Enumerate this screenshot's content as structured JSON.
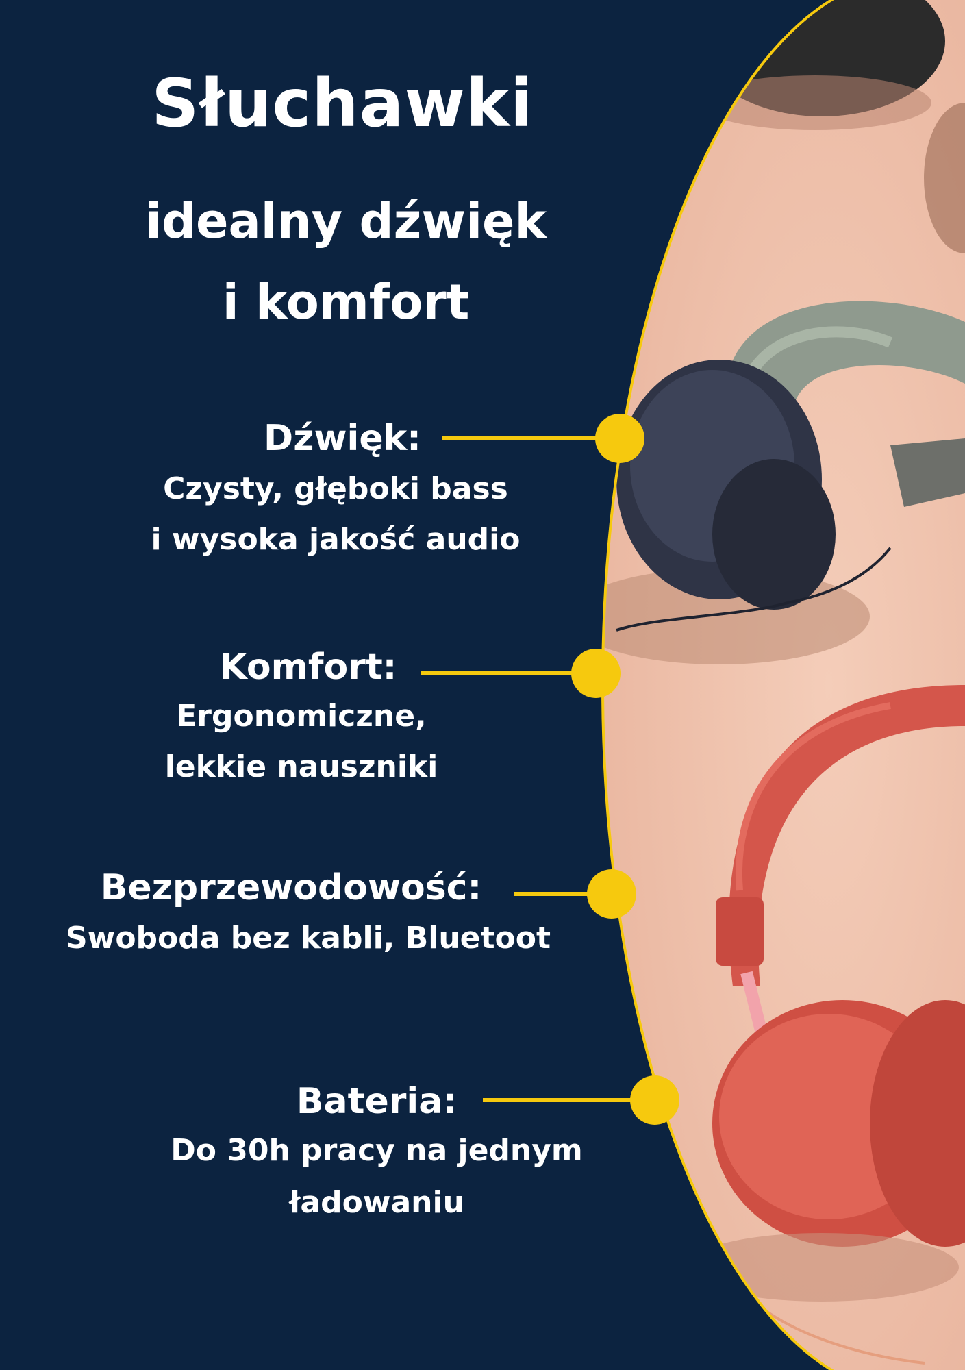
{
  "title": "Słuchawki",
  "subtitle": [
    "idealny dźwięk",
    "i komfort"
  ],
  "features": [
    {
      "label": "Dźwięk:",
      "lines": [
        "Czysty, głęboki bass",
        "i wysoka jakość audio"
      ]
    },
    {
      "label": "Komfort:",
      "lines": [
        "Ergonomiczne,",
        "lekkie nauszniki"
      ]
    },
    {
      "label": "Bezprzewodowość:",
      "lines": [
        "Swoboda bez kabli, Bluetoot"
      ]
    },
    {
      "label": "Bateria:",
      "lines": [
        "Do 30h pracy na jednym",
        "ładowaniu"
      ]
    }
  ],
  "colors": {
    "background": "#0c2340",
    "accent": "#f6c90e",
    "photo_backdrop": "#f0c2ad",
    "text": "#ffffff"
  }
}
